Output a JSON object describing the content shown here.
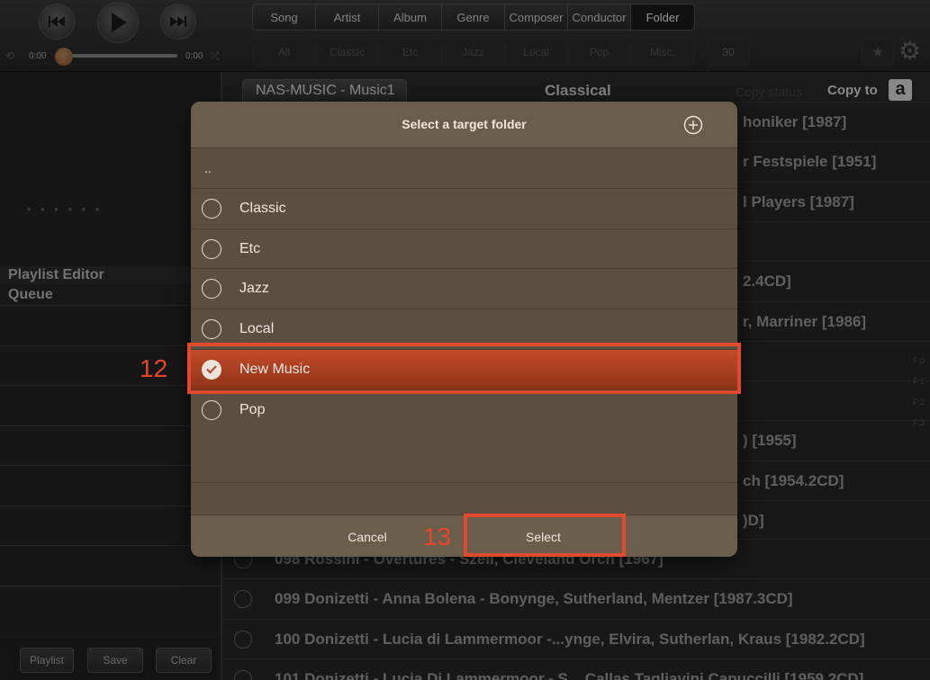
{
  "player": {
    "elapsed": "0:00",
    "remaining": "0:00",
    "progress_fraction": 0.0
  },
  "browse_tabs": [
    "Song",
    "Artist",
    "Album",
    "Genre",
    "Composer",
    "Conductor",
    "Folder"
  ],
  "active_browse_tab": "Folder",
  "genre_tabs": [
    "All",
    "Classic",
    "Etc",
    "Jazz",
    "Local",
    "Pop",
    "Misc."
  ],
  "count": "30",
  "sidebar": {
    "playlist_editor_label": "Playlist Editor",
    "queue_label": "Queue",
    "footer_buttons": [
      "Playlist",
      "Save",
      "Clear"
    ]
  },
  "main": {
    "back_label": "NAS-MUSIC - Music1",
    "title": "Classical",
    "copy_status_label": "Copy status",
    "copy_to_label": "Copy to",
    "amazon_letter": "a",
    "partial_rows": [
      "honiker [1987]",
      "r Festspiele [1951]",
      "l Players [1987]",
      "",
      "2.4CD]",
      "r, Marriner [1986]",
      "",
      "",
      ") [1955]",
      "ch [1954.2CD]",
      ")D]"
    ],
    "tracks": [
      "098 Rossini - Overtures - Szell, Cleveland Orch [1967]",
      "099 Donizetti - Anna Bolena - Bonynge, Sutherland, Mentzer [1987.3CD]",
      "100 Donizetti - Lucia di Lammermoor -...ynge, Elvira, Sutherlan, Kraus [1982.2CD]",
      "101 Donizetti - Lucia Di Lammermoor - S... Callas Tagliavini Capuccilli [1959.2CD]"
    ],
    "format_marks": [
      "F:0",
      "F:1",
      "F:2",
      "F:3"
    ]
  },
  "modal": {
    "title": "Select a target folder",
    "parent_entry": "..",
    "folders": [
      "Classic",
      "Etc",
      "Jazz",
      "Local",
      "New Music",
      "Pop"
    ],
    "selected_folder": "New Music",
    "cancel_label": "Cancel",
    "select_label": "Select"
  },
  "annotations": {
    "step_a": "12",
    "step_b": "13",
    "color": "#e24a2d"
  }
}
